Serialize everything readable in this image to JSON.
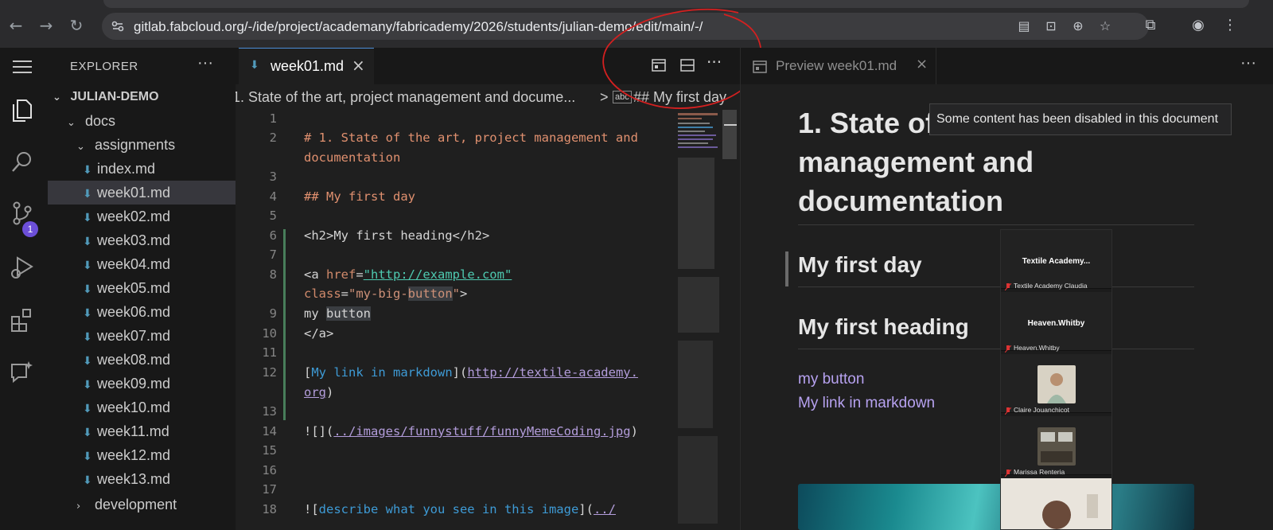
{
  "browser": {
    "url": "gitlab.fabcloud.org/-/ide/project/academany/fabricademy/2026/students/julian-demo/edit/main/-/",
    "nav_icons": [
      "back-arrow-icon",
      "forward-arrow-icon",
      "reload-icon"
    ]
  },
  "activity_bar": {
    "icons": [
      "menu-icon",
      "files-icon",
      "search-icon",
      "source-control-icon",
      "run-debug-icon",
      "extensions-icon",
      "copilot-icon"
    ],
    "source_control_badge": "1"
  },
  "explorer": {
    "title": "EXPLORER",
    "more": "···",
    "root": "JULIAN-DEMO",
    "folders": {
      "docs": "docs",
      "assignments": "assignments",
      "development": "development"
    },
    "files": [
      "index.md",
      "week01.md",
      "week02.md",
      "week03.md",
      "week04.md",
      "week05.md",
      "week06.md",
      "week07.md",
      "week08.md",
      "week09.md",
      "week10.md",
      "week11.md",
      "week12.md",
      "week13.md"
    ],
    "selected_file": "week01.md"
  },
  "editor": {
    "tab_label": "week01.md",
    "tab_close": "×",
    "more": "···",
    "breadcrumb": {
      "section": "1. State of the art, project management and docume...",
      "separator": ">",
      "symbol_icon": "abc",
      "current": "## My first day"
    },
    "line_numbers": [
      "1",
      "2",
      "3",
      "4",
      "5",
      "6",
      "7",
      "8",
      "9",
      "10",
      "11",
      "12",
      "13",
      "14",
      "15",
      "16",
      "17",
      "18"
    ],
    "code": {
      "l2a": "# 1. State of the art, project management and",
      "l2b": "documentation",
      "l4": "## My first day",
      "l6": "<h2>My first heading</h2>",
      "l8_open": "<a ",
      "l8_attr": "href",
      "l8_eq": "=",
      "l8_url": "\"http://example.com\"",
      "l8b_attr": "class",
      "l8b_eq": "=",
      "l8b_val1": "\"my-big-",
      "l8b_val2": "button",
      "l8b_val3": "\"",
      "l8b_close": ">",
      "l9_text": "my ",
      "l9_hl": "button",
      "l10": "</a>",
      "l12_lb": "[",
      "l12_text": "My link in markdown",
      "l12_mid": "](",
      "l12_url": "http://textile-academy.",
      "l12b_url": "org",
      "l12b_end": ")",
      "l14_start": "![](",
      "l14_url": "../images/funnystuff/funnyMemeCoding.jpg",
      "l14_end": ")",
      "l18_start": "![",
      "l18_text": "describe what you see in this image",
      "l18_mid": "](",
      "l18_url": "../"
    }
  },
  "preview": {
    "tab_label": "Preview week01.md",
    "tab_close": "×",
    "more": "···",
    "h1_line1": "1. State of",
    "h1_line2": "management and",
    "h1_line3": "documentation",
    "h2_first_day": "My first day",
    "h2_first_heading": "My first heading",
    "link_button": "my button",
    "link_markdown": "My link in markdown",
    "tooltip": "Some content has been disabled in this document"
  },
  "video_call": {
    "participants": [
      {
        "tile_title": "Textile  Academy...",
        "name": "Textile Academy Claudia"
      },
      {
        "tile_title": "Heaven.Whitby",
        "name": "Heaven.Whitby"
      },
      {
        "tile_title": "",
        "name": "Claire Jouanchicot"
      },
      {
        "tile_title": "",
        "name": "Marissa Renteria"
      }
    ]
  },
  "colors": {
    "annotation_circle": "#d42020",
    "accent_blue": "#4c8dd8",
    "badge_purple": "#6c4fd8",
    "preview_link": "#b7a2f0"
  }
}
